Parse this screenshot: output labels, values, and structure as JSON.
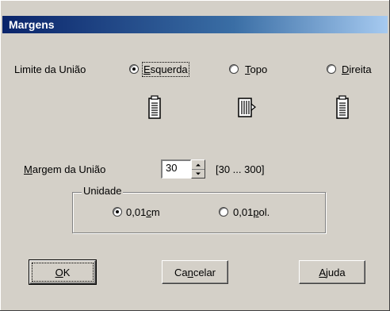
{
  "dialog": {
    "title": "Margens"
  },
  "binding_limit": {
    "label": "Limite da União",
    "options": [
      {
        "prefix": "",
        "mnemonic": "E",
        "rest": "squerda",
        "selected": true
      },
      {
        "prefix": "",
        "mnemonic": "T",
        "rest": "opo",
        "selected": false
      },
      {
        "prefix": "",
        "mnemonic": "D",
        "rest": "ireita",
        "selected": false
      }
    ],
    "icons": [
      "binding-left-icon",
      "binding-top-icon",
      "binding-right-icon"
    ]
  },
  "binding_margin": {
    "label_mnemonic": "M",
    "label_rest": "argem da União",
    "value": "30",
    "range": "[30 ... 300]"
  },
  "unit": {
    "legend": "Unidade",
    "options": [
      {
        "prefix": "0,01",
        "mnemonic": "c",
        "rest": "m",
        "selected": true
      },
      {
        "prefix": "0,01",
        "mnemonic": "p",
        "rest": "ol.",
        "selected": false
      }
    ]
  },
  "buttons": {
    "ok": {
      "mnemonic": "O",
      "rest": "K"
    },
    "cancel": {
      "prefix": "Ca",
      "mnemonic": "n",
      "rest": "celar"
    },
    "help": {
      "prefix": "",
      "mnemonic": "A",
      "rest": "juda"
    }
  }
}
